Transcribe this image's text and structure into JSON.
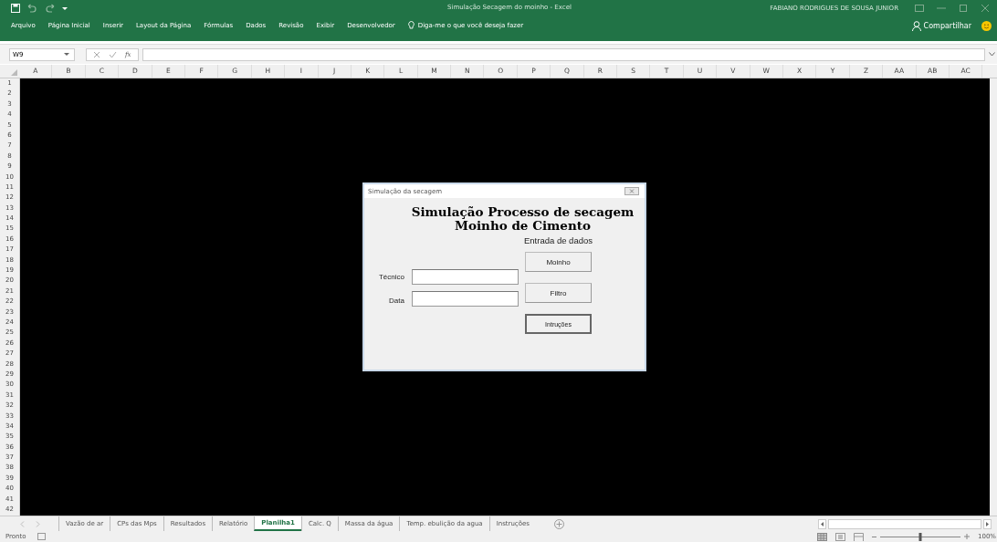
{
  "window": {
    "title": "Simulação Secagem do moinho - Excel",
    "user": "FABIANO RODRIGUES DE SOUSA JUNIOR"
  },
  "ribbon_tabs": [
    {
      "label": "Arquivo"
    },
    {
      "label": "Página Inicial"
    },
    {
      "label": "Inserir"
    },
    {
      "label": "Layout da Página"
    },
    {
      "label": "Fórmulas"
    },
    {
      "label": "Dados"
    },
    {
      "label": "Revisão"
    },
    {
      "label": "Exibir"
    },
    {
      "label": "Desenvolvedor"
    }
  ],
  "tell_me": "Diga-me o que você deseja fazer",
  "share": "Compartilhar",
  "formula_bar": {
    "name_box": "W9",
    "fx": "fx"
  },
  "columns": [
    "A",
    "B",
    "C",
    "D",
    "E",
    "F",
    "G",
    "H",
    "I",
    "J",
    "K",
    "L",
    "M",
    "N",
    "O",
    "P",
    "Q",
    "R",
    "S",
    "T",
    "U",
    "V",
    "W",
    "X",
    "Y",
    "Z",
    "AA",
    "AB",
    "AC"
  ],
  "rows": [
    "1",
    "2",
    "3",
    "4",
    "5",
    "6",
    "7",
    "8",
    "9",
    "10",
    "11",
    "12",
    "13",
    "14",
    "15",
    "16",
    "17",
    "18",
    "19",
    "20",
    "21",
    "22",
    "23",
    "24",
    "25",
    "26",
    "27",
    "28",
    "29",
    "30",
    "31",
    "32",
    "33",
    "34",
    "35",
    "36",
    "37",
    "38",
    "39",
    "40",
    "41",
    "42"
  ],
  "dialog": {
    "title": "Simulação da secagem",
    "heading": [
      "Simulação Processo de secagem",
      "Moinho de Cimento"
    ],
    "section": "Entrada de dados",
    "fields": [
      {
        "label": "Técnico"
      },
      {
        "label": "Data"
      }
    ],
    "buttons": [
      {
        "label": "Moinho",
        "focused": false
      },
      {
        "label": "Filtro",
        "focused": false
      },
      {
        "label": "Intruções",
        "focused": true
      }
    ]
  },
  "sheet_tabs": [
    {
      "label": "Vazão de ar",
      "selected": false
    },
    {
      "label": "CPs das Mps",
      "selected": false
    },
    {
      "label": "Resultados",
      "selected": false
    },
    {
      "label": "Relatório",
      "selected": false
    },
    {
      "label": "Planilha1",
      "selected": true
    },
    {
      "label": "Calc. Q",
      "selected": false
    },
    {
      "label": "Massa da água",
      "selected": false
    },
    {
      "label": "Temp. ebulição da agua",
      "selected": false
    },
    {
      "label": "Instruções",
      "selected": false
    }
  ],
  "status_bar": {
    "state": "Pronto",
    "zoom": "100%",
    "zoom_slider": {
      "level": 0.5
    }
  }
}
